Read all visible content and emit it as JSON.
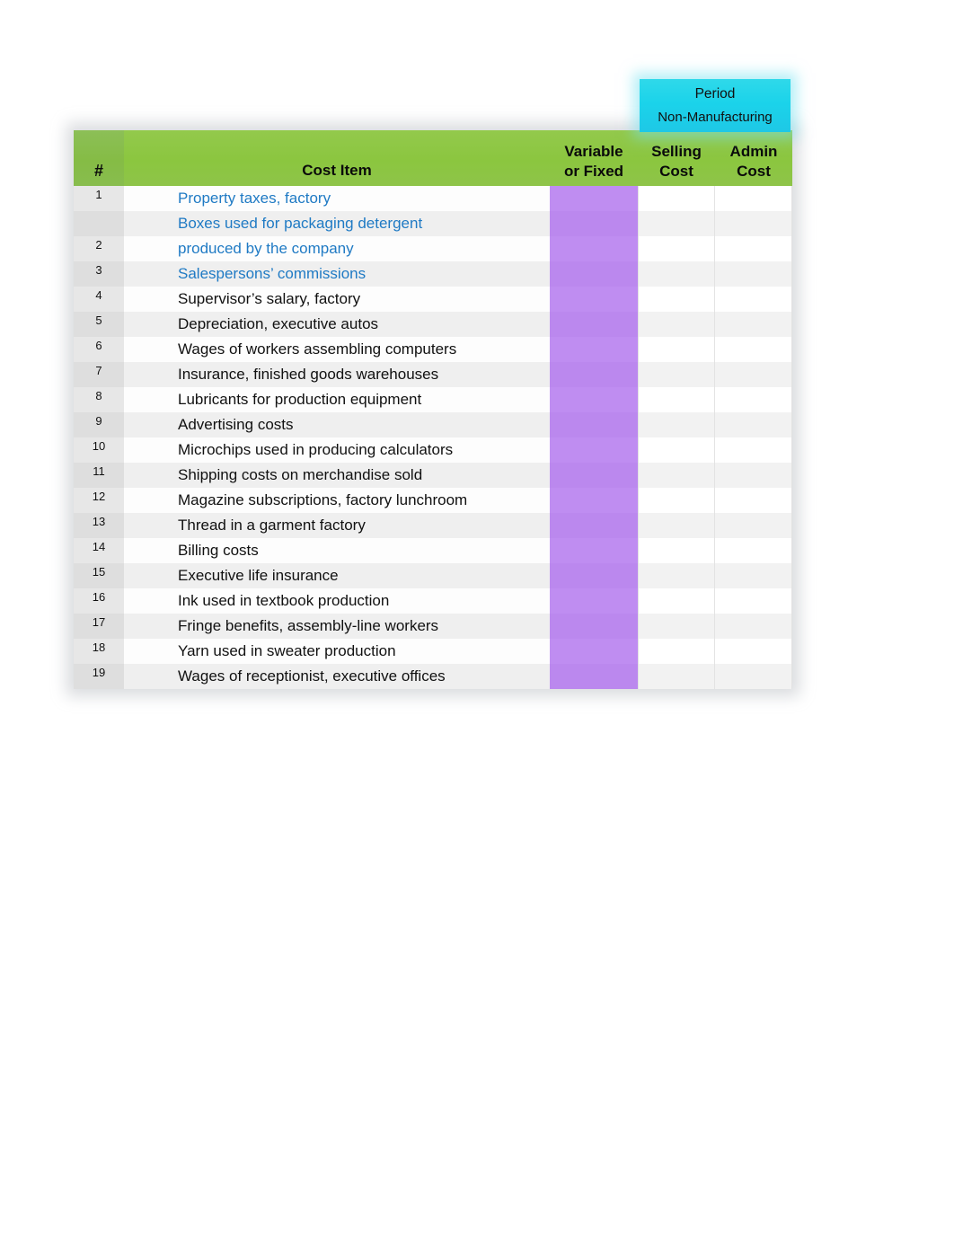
{
  "period_banner": {
    "title": "Period",
    "subtitle": "Non-Manufacturing"
  },
  "table": {
    "headers": {
      "num": "#",
      "cost_item": "Cost Item",
      "variable_or_fixed_line1": "Variable",
      "variable_or_fixed_line2": "or Fixed",
      "selling_cost_line1": "Selling",
      "selling_cost_line2": "Cost",
      "admin_cost_line1": "Admin",
      "admin_cost_line2": "Cost"
    },
    "rows": [
      {
        "num": "1",
        "item": "Property taxes, factory",
        "item_line2": "",
        "style": "link",
        "variable_or_fixed": "",
        "selling_cost": "",
        "admin_cost": ""
      },
      {
        "num": "2",
        "item": "Boxes used for packaging detergent",
        "item_line2": "produced by the company",
        "style": "link",
        "variable_or_fixed": "",
        "selling_cost": "",
        "admin_cost": ""
      },
      {
        "num": "3",
        "item": "Salespersons’ commissions",
        "item_line2": "",
        "style": "link",
        "variable_or_fixed": "",
        "selling_cost": "",
        "admin_cost": ""
      },
      {
        "num": "4",
        "item": "Supervisor’s salary, factory",
        "item_line2": "",
        "style": "plain",
        "variable_or_fixed": "",
        "selling_cost": "",
        "admin_cost": ""
      },
      {
        "num": "5",
        "item": "Depreciation, executive autos",
        "item_line2": "",
        "style": "plain",
        "variable_or_fixed": "",
        "selling_cost": "",
        "admin_cost": ""
      },
      {
        "num": "6",
        "item": "Wages of workers assembling computers",
        "item_line2": "",
        "style": "plain",
        "variable_or_fixed": "",
        "selling_cost": "",
        "admin_cost": ""
      },
      {
        "num": "7",
        "item": "Insurance, finished goods warehouses",
        "item_line2": "",
        "style": "plain",
        "variable_or_fixed": "",
        "selling_cost": "",
        "admin_cost": ""
      },
      {
        "num": "8",
        "item": "Lubricants for production equipment",
        "item_line2": "",
        "style": "plain",
        "variable_or_fixed": "",
        "selling_cost": "",
        "admin_cost": ""
      },
      {
        "num": "9",
        "item": "Advertising costs",
        "item_line2": "",
        "style": "plain",
        "variable_or_fixed": "",
        "selling_cost": "",
        "admin_cost": ""
      },
      {
        "num": "10",
        "item": "Microchips used in producing calculators",
        "item_line2": "",
        "style": "plain",
        "variable_or_fixed": "",
        "selling_cost": "",
        "admin_cost": ""
      },
      {
        "num": "11",
        "item": "Shipping costs on merchandise sold",
        "item_line2": "",
        "style": "plain",
        "variable_or_fixed": "",
        "selling_cost": "",
        "admin_cost": ""
      },
      {
        "num": "12",
        "item": "Magazine subscriptions, factory lunchroom",
        "item_line2": "",
        "style": "plain",
        "variable_or_fixed": "",
        "selling_cost": "",
        "admin_cost": ""
      },
      {
        "num": "13",
        "item": "Thread in a garment factory",
        "item_line2": "",
        "style": "plain",
        "variable_or_fixed": "",
        "selling_cost": "",
        "admin_cost": ""
      },
      {
        "num": "14",
        "item": "Billing costs",
        "item_line2": "",
        "style": "plain",
        "variable_or_fixed": "",
        "selling_cost": "",
        "admin_cost": ""
      },
      {
        "num": "15",
        "item": "Executive life insurance",
        "item_line2": "",
        "style": "plain",
        "variable_or_fixed": "",
        "selling_cost": "",
        "admin_cost": ""
      },
      {
        "num": "16",
        "item": "Ink used in textbook production",
        "item_line2": "",
        "style": "plain",
        "variable_or_fixed": "",
        "selling_cost": "",
        "admin_cost": ""
      },
      {
        "num": "17",
        "item": "Fringe benefits, assembly-line workers",
        "item_line2": "",
        "style": "plain",
        "variable_or_fixed": "",
        "selling_cost": "",
        "admin_cost": ""
      },
      {
        "num": "18",
        "item": "Yarn used in sweater production",
        "item_line2": "",
        "style": "plain",
        "variable_or_fixed": "",
        "selling_cost": "",
        "admin_cost": ""
      },
      {
        "num": "19",
        "item": "Wages of receptionist, executive offices",
        "item_line2": "",
        "style": "plain",
        "variable_or_fixed": "",
        "selling_cost": "",
        "admin_cost": ""
      }
    ]
  },
  "colors": {
    "header_green": "#8BC63F",
    "period_cyan": "#1BD3EA",
    "variable_fixed_purple": "#BF8DF1",
    "link_blue": "#1F7AC4",
    "row_light": "#FDFDFD",
    "row_alt": "#EFEFEF"
  }
}
